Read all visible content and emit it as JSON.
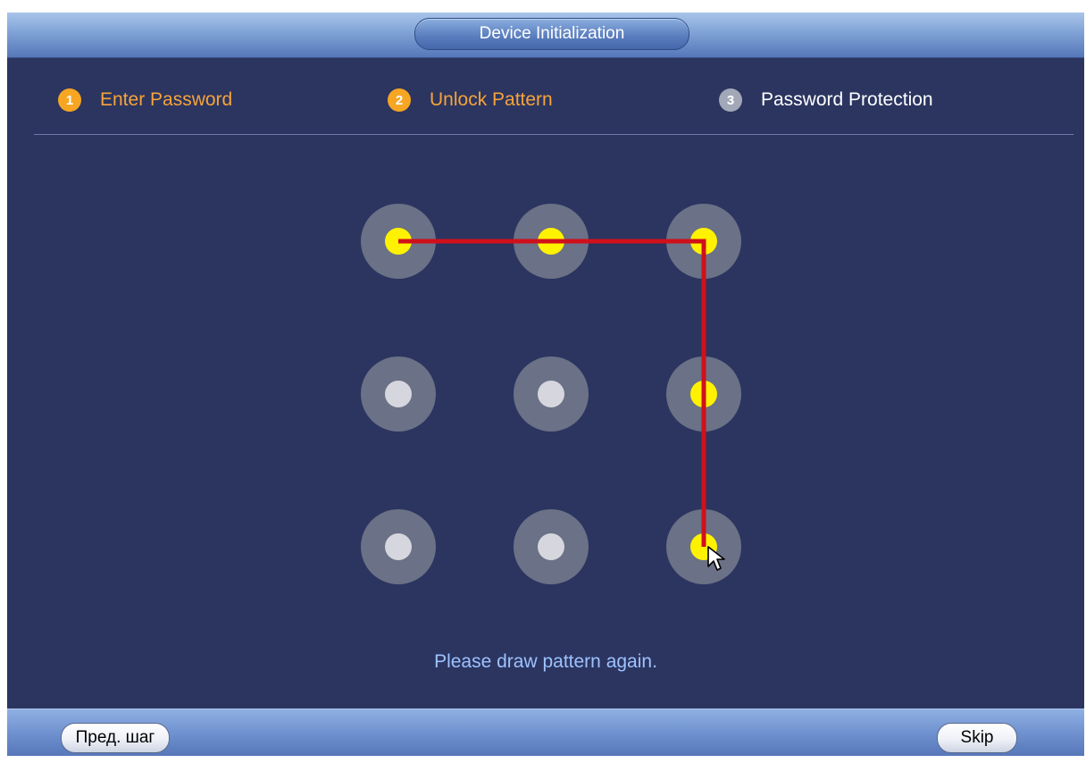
{
  "window": {
    "title": "Device Initialization"
  },
  "steps": [
    {
      "number": "1",
      "label": "Enter Password",
      "state": "active"
    },
    {
      "number": "2",
      "label": "Unlock Pattern",
      "state": "active"
    },
    {
      "number": "3",
      "label": "Password Protection",
      "state": "inactive"
    }
  ],
  "pattern": {
    "grid_size": 3,
    "selected_dots": [
      1,
      2,
      3,
      6,
      9
    ],
    "path_order": [
      1,
      2,
      3,
      6,
      9
    ],
    "line_color": "#d0101a",
    "selected_color": "#fff200",
    "unselected_color": "#d6d7de"
  },
  "message": "Please draw pattern again.",
  "footer": {
    "prev_label": "Пред. шаг",
    "skip_label": "Skip"
  },
  "colors": {
    "background": "#2b3560",
    "active_step": "#f7a33a",
    "message": "#9ec2ff"
  },
  "icons": {
    "cursor": "mouse-pointer-icon"
  }
}
